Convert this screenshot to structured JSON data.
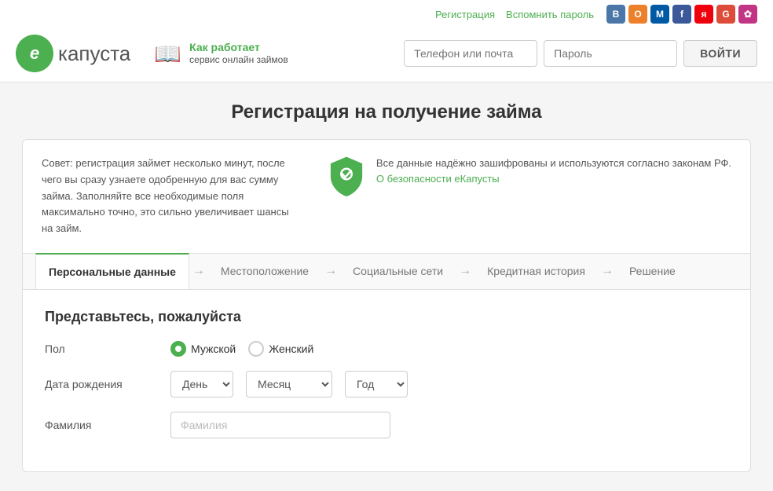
{
  "header": {
    "logo": {
      "letter": "е",
      "name": "капуста"
    },
    "how_it_works": {
      "line1": "Как работает",
      "line2": "сервис онлайн займов"
    },
    "top_links": {
      "register": "Регистрация",
      "forgot_password": "Вспомнить пароль"
    },
    "login": {
      "phone_placeholder": "Телефон или почта",
      "password_placeholder": "Пароль",
      "button_label": "ВОЙТИ"
    },
    "social": [
      {
        "name": "vk",
        "label": "В",
        "class": "si-vk"
      },
      {
        "name": "ok",
        "label": "О",
        "class": "si-ok"
      },
      {
        "name": "mail",
        "label": "М",
        "class": "si-mail"
      },
      {
        "name": "fb",
        "label": "f",
        "class": "si-fb"
      },
      {
        "name": "ya",
        "label": "я",
        "class": "si-ya"
      },
      {
        "name": "g",
        "label": "G",
        "class": "si-g"
      },
      {
        "name": "ig",
        "label": "✿",
        "class": "si-ig"
      }
    ]
  },
  "page": {
    "title": "Регистрация на получение займа"
  },
  "tip": {
    "text": "Совет: регистрация займет несколько минут, после чего вы сразу узнаете одобренную для вас сумму займа. Заполняйте все необходимые поля максимально точно, это сильно увеличивает шансы на займ.",
    "security_text": "Все данные надёжно зашифрованы и используются согласно законам РФ.",
    "security_link": "О безопасности еКапусты"
  },
  "steps": [
    {
      "label": "Персональные данные",
      "active": true
    },
    {
      "label": "Местоположение",
      "active": false
    },
    {
      "label": "Социальные сети",
      "active": false
    },
    {
      "label": "Кредитная история",
      "active": false
    },
    {
      "label": "Решение",
      "active": false
    }
  ],
  "form": {
    "subtitle": "Представьтесь, пожалуйста",
    "gender_label": "Пол",
    "gender_options": [
      {
        "value": "male",
        "label": "Мужской",
        "checked": true
      },
      {
        "value": "female",
        "label": "Женский",
        "checked": false
      }
    ],
    "dob_label": "Дата рождения",
    "dob_day_placeholder": "День",
    "dob_month_placeholder": "Месяц",
    "dob_year_placeholder": "Год",
    "surname_label": "Фамилия",
    "surname_placeholder": "Фамилия"
  }
}
